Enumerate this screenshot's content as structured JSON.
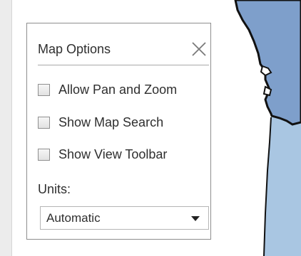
{
  "panel": {
    "title": "Map Options",
    "close_icon": "close-icon",
    "options": [
      {
        "label": "Allow Pan and Zoom",
        "checked": false
      },
      {
        "label": "Show Map Search",
        "checked": false
      },
      {
        "label": "Show View Toolbar",
        "checked": false
      }
    ],
    "units_label": "Units:",
    "units_select": {
      "value": "Automatic",
      "icon": "chevron-down-icon"
    }
  },
  "colors": {
    "land": "#ffffff",
    "water_dark": "#7e9fcb",
    "water_light": "#a9c6e2",
    "coast_stroke": "#111111"
  }
}
